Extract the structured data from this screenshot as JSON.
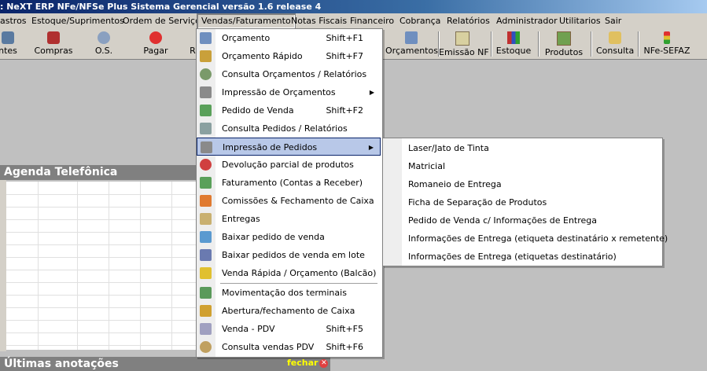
{
  "window": {
    "title": ": NeXT ERP NFe/NFSe Plus Sistema Gerencial  versão 1.6 release 4"
  },
  "menubar": {
    "items": [
      {
        "label": "astros"
      },
      {
        "label": "Estoque/Suprimentos"
      },
      {
        "label": "Ordem de Serviço"
      },
      {
        "label": "Vendas/Faturamento"
      },
      {
        "label": "Notas Fiscais"
      },
      {
        "label": "Financeiro"
      },
      {
        "label": "Cobrança"
      },
      {
        "label": "Relatórios"
      },
      {
        "label": "Administrador"
      },
      {
        "label": "Utilitarios"
      },
      {
        "label": "Sair"
      }
    ]
  },
  "toolbar": {
    "items": [
      {
        "label": "ntes",
        "icon": "clients-icon"
      },
      {
        "label": "Compras",
        "icon": "cart-icon"
      },
      {
        "label": "O.S.",
        "icon": "gears-icon"
      },
      {
        "label": "Pagar",
        "icon": "stop-icon"
      },
      {
        "label": "R",
        "icon": ""
      },
      {
        "label": "Orçamentos",
        "icon": "budget-icon"
      },
      {
        "label": "Emissão NF",
        "icon": "invoice-icon"
      },
      {
        "label": "Estoque",
        "icon": "books-icon"
      },
      {
        "label": "Produtos",
        "icon": "picture-icon"
      },
      {
        "label": "Consulta",
        "icon": "search-person-icon"
      },
      {
        "label": "NFe-SEFAZ",
        "icon": "traffic-light-icon"
      }
    ]
  },
  "dropdown": {
    "items": [
      {
        "label": "Orçamento",
        "shortcut": "Shift+F1",
        "color": "#6f8fbf"
      },
      {
        "label": "Orçamento Rápido",
        "shortcut": "Shift+F7",
        "color": "#c9a03a"
      },
      {
        "label": "Consulta Orçamentos / Relatórios",
        "shortcut": "",
        "color": "#7a9a6a"
      },
      {
        "label": "Impressão de Orçamentos",
        "shortcut": "",
        "color": "#8a8a8a",
        "submenu": true
      },
      {
        "label": "Pedido de Venda",
        "shortcut": "Shift+F2",
        "color": "#5aa05a"
      },
      {
        "label": "Consulta Pedidos / Relatórios",
        "shortcut": "",
        "color": "#8aa0a0"
      },
      {
        "label": "Impressão de Pedidos",
        "shortcut": "",
        "color": "#8a8a8a",
        "submenu": true,
        "highlighted": true
      },
      {
        "label": "Devolução parcial de produtos",
        "shortcut": "",
        "color": "#d04040"
      },
      {
        "label": "Faturamento (Contas a Receber)",
        "shortcut": "",
        "color": "#5aa05a"
      },
      {
        "label": "Comissões & Fechamento de Caixa",
        "shortcut": "",
        "color": "#e07a30"
      },
      {
        "label": "Entregas",
        "shortcut": "",
        "color": "#c9b070"
      },
      {
        "label": "Baixar pedido de venda",
        "shortcut": "",
        "color": "#5a9ad0"
      },
      {
        "label": "Baixar pedidos de venda em lote",
        "shortcut": "",
        "color": "#6a7ab0"
      },
      {
        "label": "Venda Rápida / Orçamento (Balcão)",
        "shortcut": "",
        "color": "#e0c030"
      },
      {
        "label": "Movimentação dos terminais",
        "shortcut": "",
        "color": "#5a9a5a"
      },
      {
        "label": "Abertura/fechamento de Caixa",
        "shortcut": "",
        "color": "#d0a030"
      },
      {
        "label": "Venda - PDV",
        "shortcut": "Shift+F5",
        "color": "#a0a0c0"
      },
      {
        "label": "Consulta vendas PDV",
        "shortcut": "Shift+F6",
        "color": "#c0a060"
      }
    ]
  },
  "submenu": {
    "items": [
      {
        "label": "Laser/Jato de Tinta"
      },
      {
        "label": "Matricial"
      },
      {
        "label": "Romaneio de Entrega"
      },
      {
        "label": "Ficha de Separação de Produtos"
      },
      {
        "label": "Pedido de Venda c/ Informações de Entrega"
      },
      {
        "label": "Informações de Entrega (etiqueta destinatário x remetente)"
      },
      {
        "label": "Informações de Entrega (etiquetas destinatário)"
      }
    ]
  },
  "panels": {
    "agenda_title": "Agenda Telefônica",
    "notes_title": "Últimas anotações",
    "close_label": "fechar"
  }
}
